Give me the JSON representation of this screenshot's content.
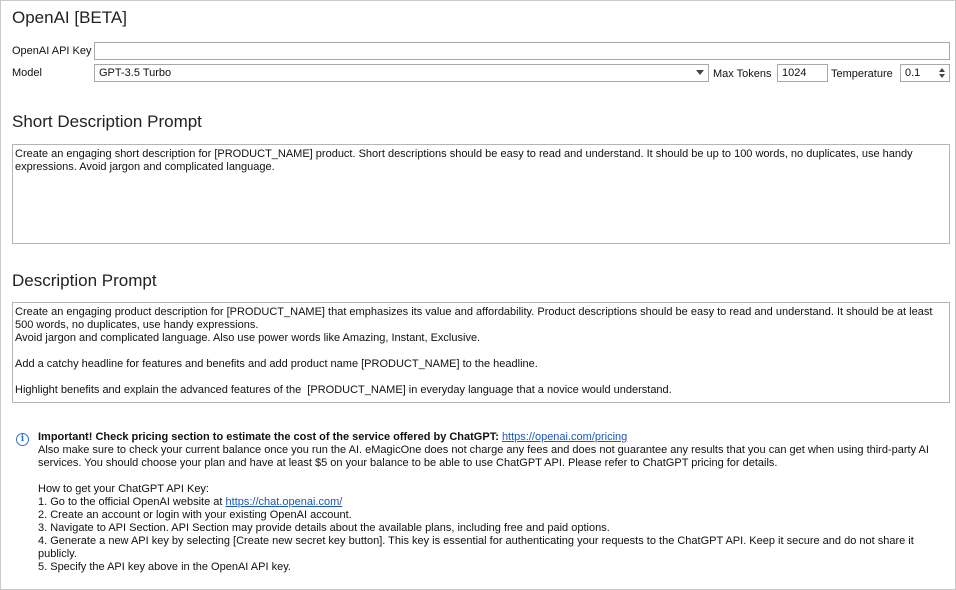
{
  "title": "OpenAI [BETA]",
  "api_key": {
    "label": "OpenAI API Key",
    "value": ""
  },
  "model": {
    "label": "Model",
    "value": "GPT-3.5 Turbo"
  },
  "max_tokens": {
    "label": "Max Tokens",
    "value": "1024"
  },
  "temperature": {
    "label": "Temperature",
    "value": "0.1"
  },
  "short_prompt": {
    "title": "Short Description Prompt",
    "text": "Create an engaging short description for [PRODUCT_NAME] product. Short descriptions should be easy to read and understand. It should be up to 100 words, no duplicates, use handy expressions. Avoid jargon and complicated language."
  },
  "desc_prompt": {
    "title": "Description Prompt",
    "text": "Create an engaging product description for [PRODUCT_NAME] that emphasizes its value and affordability. Product descriptions should be easy to read and understand. It should be at least 500 words, no duplicates, use handy expressions.\nAvoid jargon and complicated language. Also use power words like Amazing, Instant, Exclusive.\n\nAdd a catchy headline for features and benefits and add product name [PRODUCT_NAME] to the headline.\n\nHighlight benefits and explain the advanced features of the  [PRODUCT_NAME] in everyday language that a novice would understand."
  },
  "info": {
    "important": "Important! Check pricing section to estimate the cost of the service offered by ChatGPT:",
    "pricing_link": "https://openai.com/pricing",
    "balance_note": "Also make sure to check your current balance once you run the AI. eMagicOne does not charge any fees and does not guarantee any results that you can get when using third-party AI services. You should choose your plan and have at least $5 on your balance to be able to use ChatGPT API. Please refer to ChatGPT pricing for details.",
    "howto_title": "How to get your ChatGPT API Key:",
    "step1_prefix": "1. Go to the official OpenAI website at ",
    "step1_link": "https://chat.openai.com/",
    "step2": "2. Create an account or login with your existing OpenAI account.",
    "step3": "3. Navigate to API Section.  API Section may provide details about the available plans, including free and paid options.",
    "step4": "4. Generate a new API key by selecting [Create new secret key button]. This key is essential for authenticating your requests to the ChatGPT API. Keep it secure and do not share it publicly.",
    "step5": "5. Specify the API key above in the OpenAI API key."
  }
}
